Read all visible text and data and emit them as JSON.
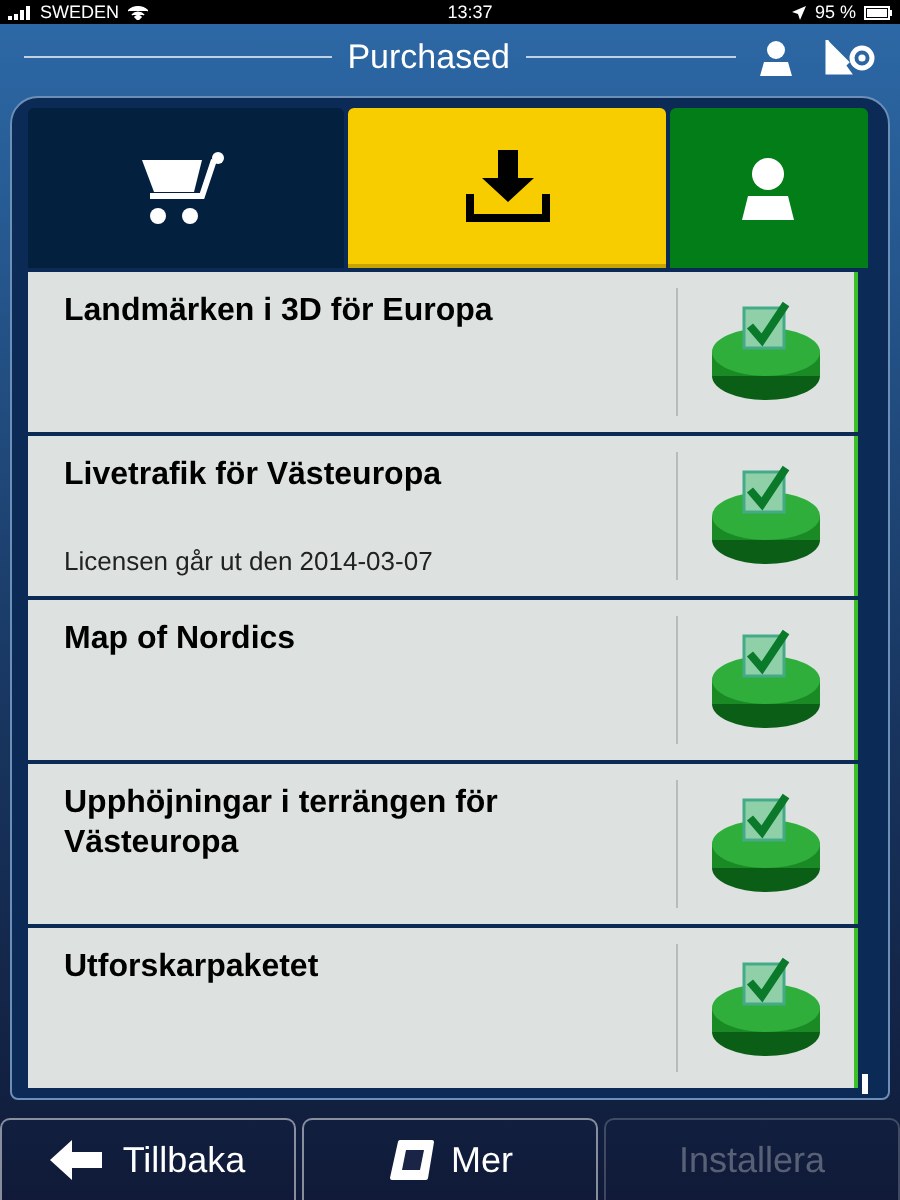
{
  "status_bar": {
    "carrier": "SWEDEN",
    "time": "13:37",
    "battery": "95 %"
  },
  "header": {
    "title": "Purchased"
  },
  "tabs": [
    {
      "kind": "cart",
      "selected": false
    },
    {
      "kind": "download",
      "selected": true
    },
    {
      "kind": "account",
      "selected": false
    }
  ],
  "items": [
    {
      "title": "Landmärken i 3D för Europa",
      "checked": true
    },
    {
      "title": "Livetrafik för Västeuropa",
      "subtitle": "Licensen går ut den 2014-03-07",
      "checked": true
    },
    {
      "title": "Map of Nordics",
      "checked": true
    },
    {
      "title": "Upphöjningar i terrängen för Västeuropa",
      "checked": true
    },
    {
      "title": "Utforskarpaketet",
      "checked": true
    }
  ],
  "buttons": [
    {
      "kind": "back",
      "label": "Tillbaka",
      "disabled": false
    },
    {
      "kind": "more",
      "label": "Mer",
      "disabled": false
    },
    {
      "kind": "install",
      "label": "Installera",
      "disabled": true
    }
  ]
}
